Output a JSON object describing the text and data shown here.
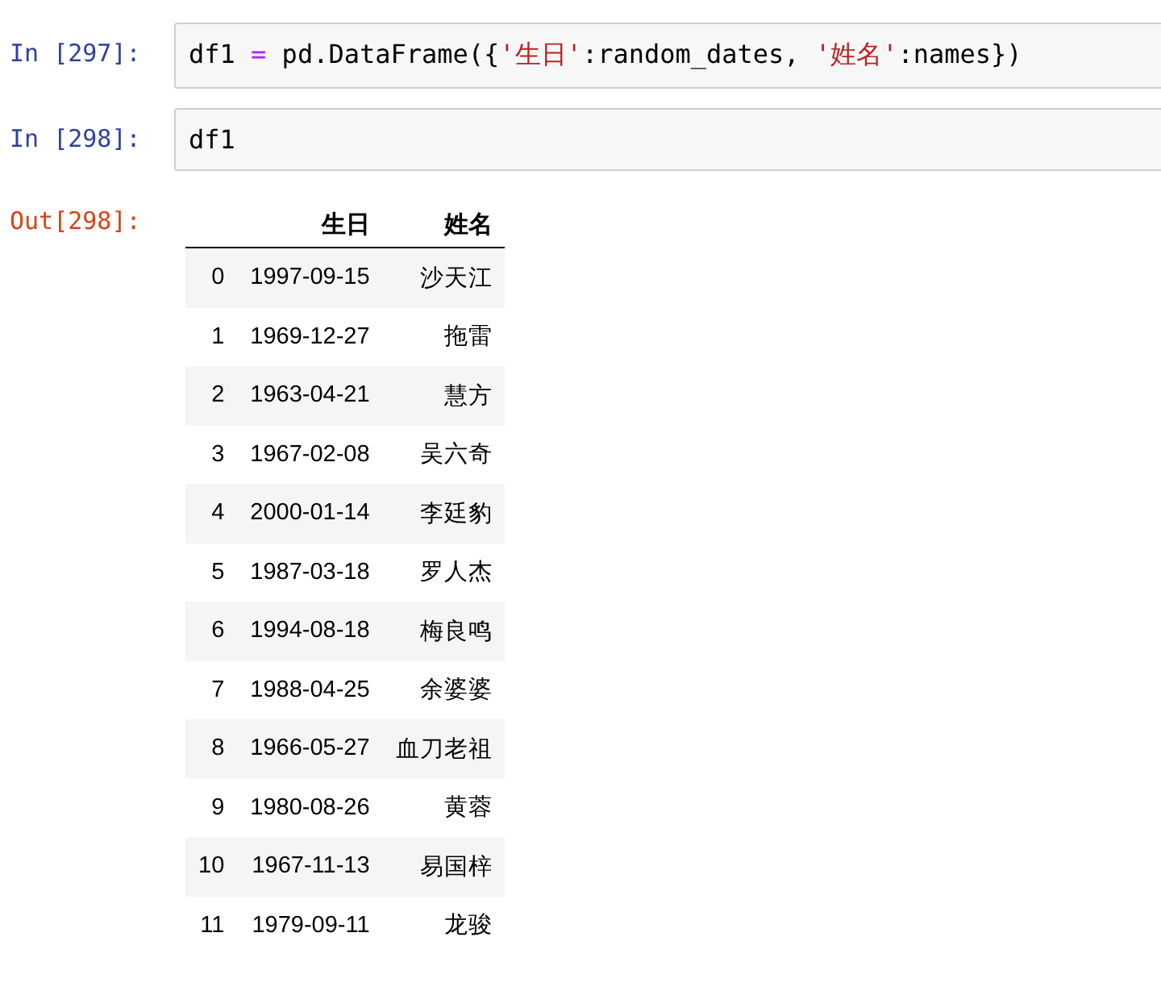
{
  "cells": [
    {
      "kind": "input",
      "prompt": "In [297]:",
      "code": [
        {
          "kind": "plain",
          "text": "df1 "
        },
        {
          "kind": "operator",
          "text": "="
        },
        {
          "kind": "plain",
          "text": " pd.DataFrame({"
        },
        {
          "kind": "string",
          "text": "'生日'"
        },
        {
          "kind": "plain",
          "text": ":random_dates, "
        },
        {
          "kind": "string",
          "text": "'姓名'"
        },
        {
          "kind": "plain",
          "text": ":names})"
        }
      ]
    },
    {
      "kind": "input",
      "prompt": "In [298]:",
      "code": [
        {
          "kind": "plain",
          "text": "df1"
        }
      ]
    },
    {
      "kind": "output",
      "prompt": "Out[298]:",
      "table": {
        "columns": [
          "",
          "生日",
          "姓名"
        ],
        "rows": [
          [
            "0",
            "1997-09-15",
            "沙天江"
          ],
          [
            "1",
            "1969-12-27",
            "拖雷"
          ],
          [
            "2",
            "1963-04-21",
            "慧方"
          ],
          [
            "3",
            "1967-02-08",
            "吴六奇"
          ],
          [
            "4",
            "2000-01-14",
            "李廷豹"
          ],
          [
            "5",
            "1987-03-18",
            "罗人杰"
          ],
          [
            "6",
            "1994-08-18",
            "梅良鸣"
          ],
          [
            "7",
            "1988-04-25",
            "余婆婆"
          ],
          [
            "8",
            "1966-05-27",
            "血刀老祖"
          ],
          [
            "9",
            "1980-08-26",
            "黄蓉"
          ],
          [
            "10",
            "1967-11-13",
            "易国梓"
          ],
          [
            "11",
            "1979-09-11",
            "龙骏"
          ]
        ]
      }
    }
  ]
}
